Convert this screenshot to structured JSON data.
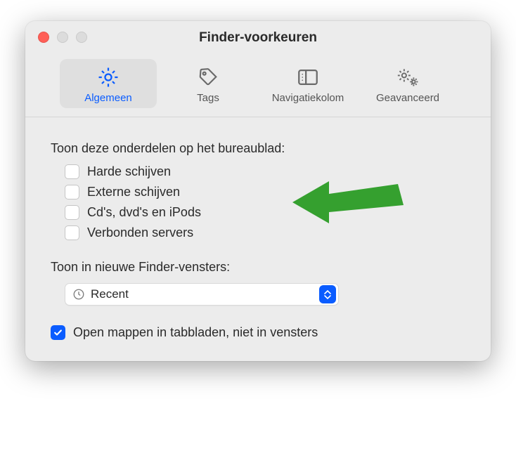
{
  "window": {
    "title": "Finder-voorkeuren"
  },
  "toolbar": {
    "items": [
      {
        "label": "Algemeen"
      },
      {
        "label": "Tags"
      },
      {
        "label": "Navigatiekolom"
      },
      {
        "label": "Geavanceerd"
      }
    ]
  },
  "desktop": {
    "heading": "Toon deze onderdelen op het bureaublad:",
    "items": [
      {
        "label": "Harde schijven",
        "checked": false
      },
      {
        "label": "Externe schijven",
        "checked": false
      },
      {
        "label": "Cd's, dvd's en iPods",
        "checked": false
      },
      {
        "label": "Verbonden servers",
        "checked": false
      }
    ]
  },
  "newWindows": {
    "heading": "Toon in nieuwe Finder-vensters:",
    "selected": "Recent"
  },
  "openInTabs": {
    "label": "Open mappen in tabbladen, niet in vensters",
    "checked": true
  },
  "colors": {
    "accent": "#0a5cff",
    "arrow": "#35a02f"
  }
}
